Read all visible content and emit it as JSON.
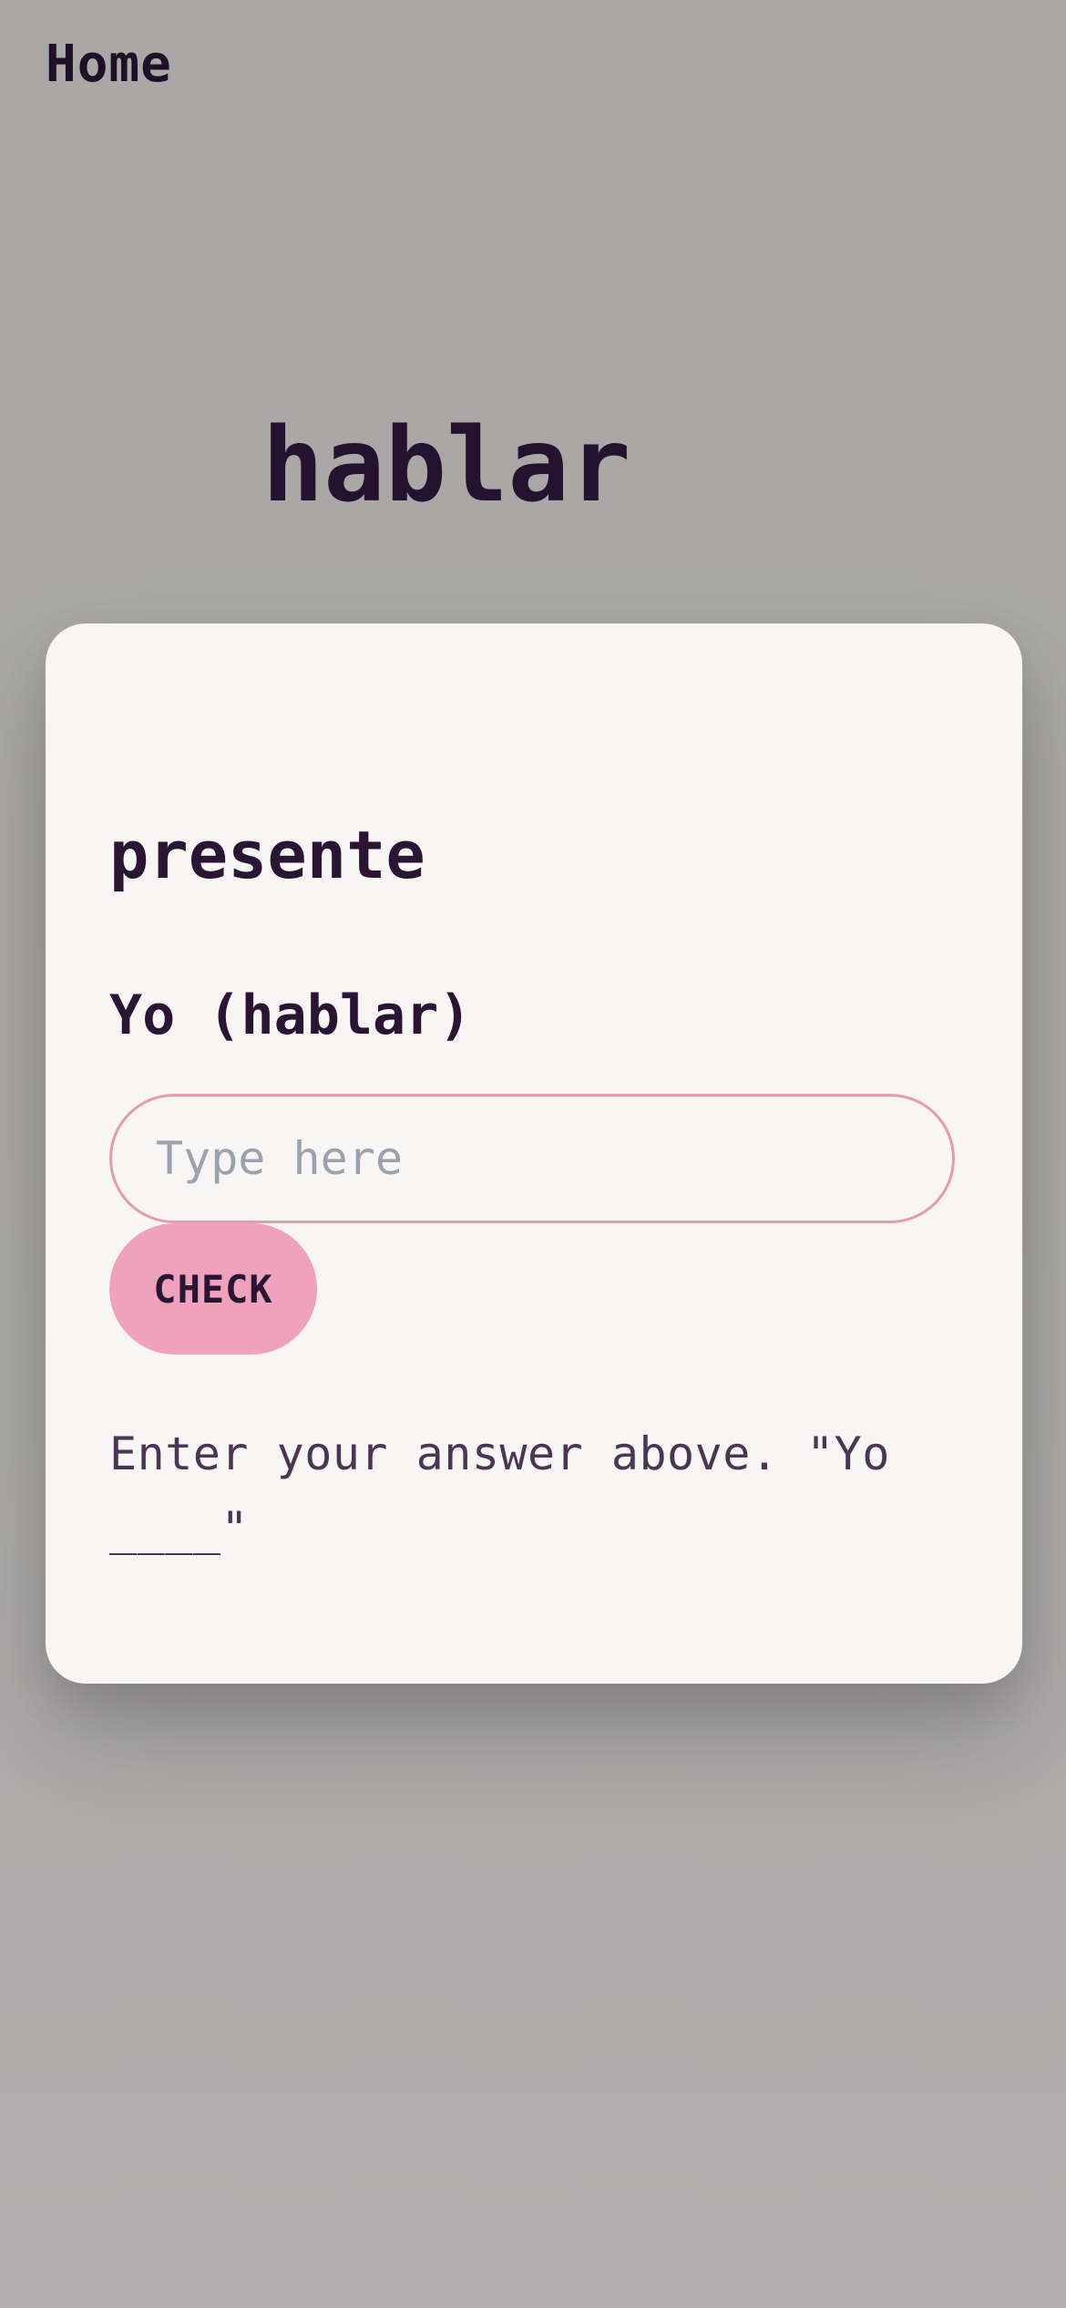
{
  "nav": {
    "home_label": "Home"
  },
  "verb": {
    "title": "hablar"
  },
  "card": {
    "tense": "presente",
    "prompt": "Yo (hablar)",
    "input": {
      "placeholder": "Type here",
      "value": ""
    },
    "check_label": "CHECK",
    "hint": "Enter your answer above. \"Yo ____\""
  },
  "colors": {
    "background": "#aaa9a7",
    "card": "#f8f6f5",
    "accent": "#f0a1bc",
    "input_border": "#e59ab2",
    "text_dark": "#24132f"
  }
}
